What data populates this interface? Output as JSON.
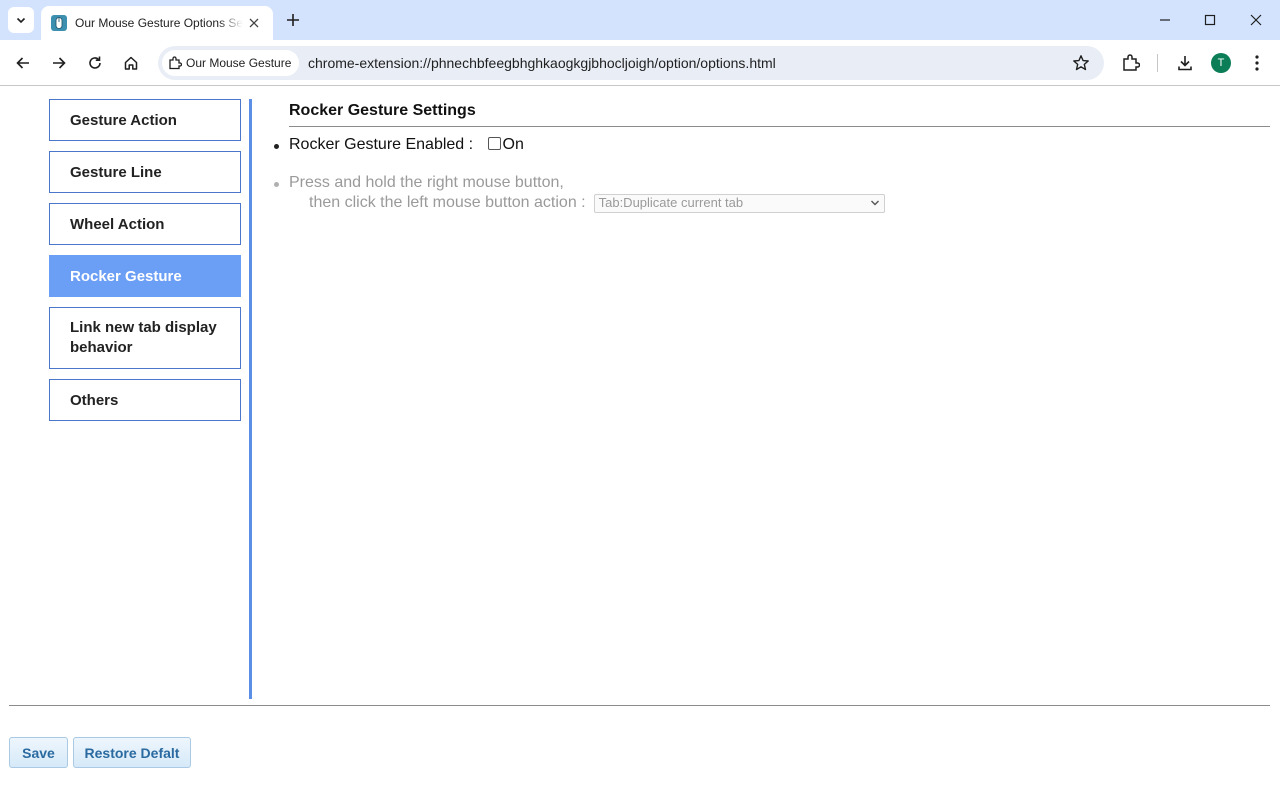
{
  "browser": {
    "tab_title": "Our Mouse Gesture Options Settings",
    "chip_label": "Our Mouse Gesture",
    "url": "chrome-extension://phnechbfeegbhghkaogkgjbhocljoigh/option/options.html",
    "profile_initial": "T",
    "accent_color": "#d3e3fd",
    "profile_color": "#0b7d57"
  },
  "sidebar": {
    "items": [
      {
        "label": "Gesture Action"
      },
      {
        "label": "Gesture Line"
      },
      {
        "label": "Wheel Action"
      },
      {
        "label": "Rocker Gesture",
        "active": true
      },
      {
        "label": "Link new tab display behavior"
      },
      {
        "label": "Others"
      }
    ],
    "active_color": "#6b9ef5"
  },
  "main": {
    "section_title": "Rocker Gesture Settings",
    "enabled_label": "Rocker Gesture Enabled :",
    "enabled_checkbox_label": "On",
    "enabled_checked": false,
    "action_line1": "Press and hold the right mouse button,",
    "action_line2": "then click the left mouse button action :",
    "action_selected": "Tab:Duplicate current tab"
  },
  "footer": {
    "save_label": "Save",
    "restore_label": "Restore Defalt"
  }
}
